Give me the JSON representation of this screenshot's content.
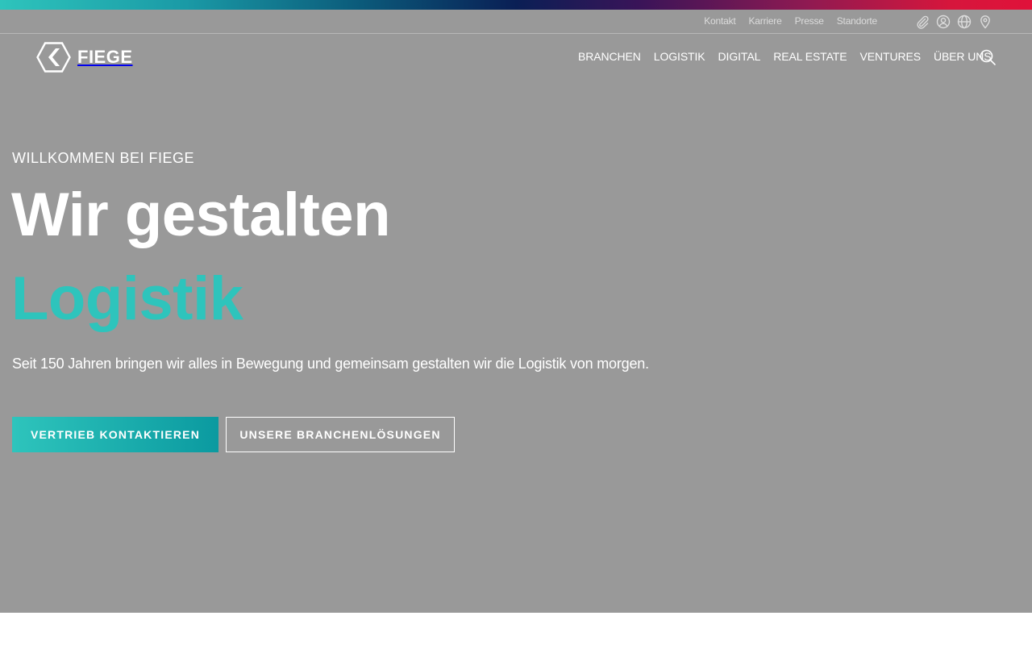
{
  "colors": {
    "accent": "#2ec4bc",
    "hero_bg": "#999999",
    "text": "#ffffff"
  },
  "utility": {
    "links": [
      "Kontakt",
      "Karriere",
      "Presse",
      "Standorte"
    ],
    "icons": [
      "paperclip-icon",
      "user-icon",
      "globe-icon",
      "location-pin-icon"
    ]
  },
  "logo": {
    "text": "FIEGE"
  },
  "nav": {
    "items": [
      "BRANCHEN",
      "LOGISTIK",
      "DIGITAL",
      "REAL ESTATE",
      "VENTURES",
      "ÜBER UNS"
    ],
    "search_icon": "search-icon"
  },
  "hero": {
    "eyebrow": "WILLKOMMEN BEI FIEGE",
    "headline_line1": "Wir gestalten",
    "headline_line2": "Logistik",
    "subtitle": "Seit 150 Jahren bringen wir alles in Bewegung und gemeinsam gestalten wir die Logistik von morgen.",
    "primary_cta": "VERTRIEB KONTAKTIEREN",
    "secondary_cta": "UNSERE BRANCHENLÖSUNGEN"
  }
}
